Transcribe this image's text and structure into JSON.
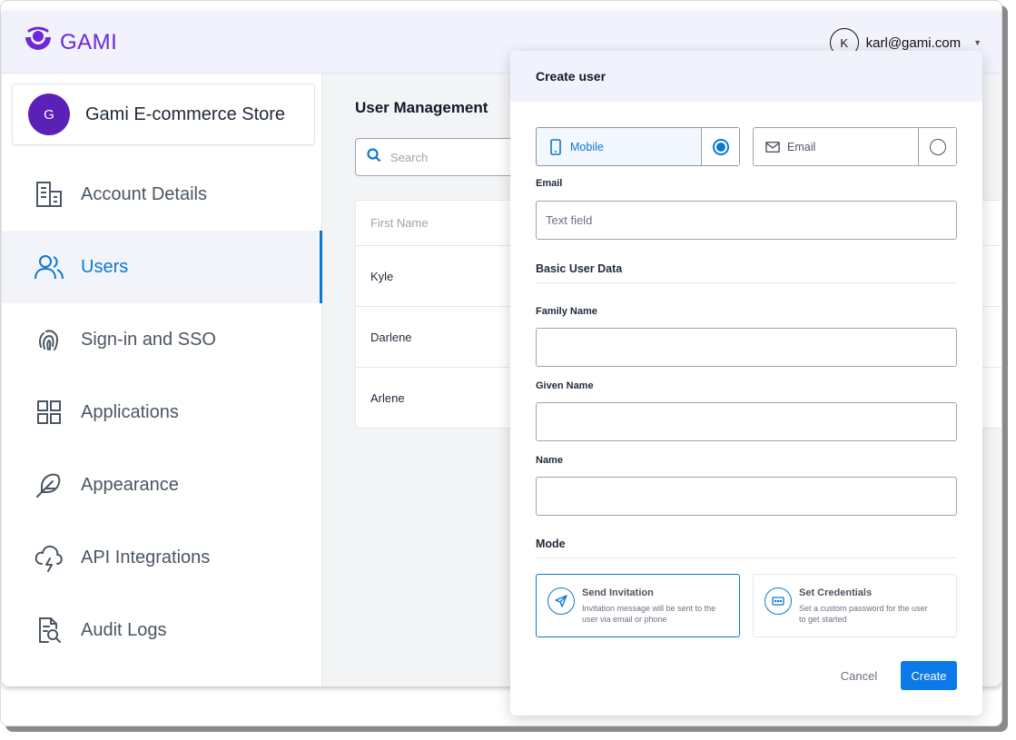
{
  "brand": {
    "name": "GAMI",
    "color": "#6d28d9"
  },
  "user_menu": {
    "avatar_initial": "K",
    "email": "karl@gami.com"
  },
  "organization": {
    "avatar_initial": "G",
    "name": "Gami E-commerce Store"
  },
  "sidebar": {
    "items": [
      {
        "label": "Account Details",
        "icon": "building-icon",
        "active": false
      },
      {
        "label": "Users",
        "icon": "users-icon",
        "active": true
      },
      {
        "label": "Sign-in and SSO",
        "icon": "fingerprint-icon",
        "active": false
      },
      {
        "label": "Applications",
        "icon": "grid-icon",
        "active": false
      },
      {
        "label": "Appearance",
        "icon": "feather-icon",
        "active": false
      },
      {
        "label": "API Integrations",
        "icon": "cloud-bolt-icon",
        "active": false
      },
      {
        "label": "Audit Logs",
        "icon": "file-search-icon",
        "active": false
      }
    ]
  },
  "main": {
    "title": "User Management",
    "search_placeholder": "Search",
    "table": {
      "header": "First Name",
      "rows": [
        "Kyle",
        "Darlene",
        "Arlene"
      ]
    }
  },
  "modal": {
    "title": "Create user",
    "contact_options": [
      {
        "label": "Mobile",
        "icon": "phone-icon",
        "selected": true
      },
      {
        "label": "Email",
        "icon": "mail-icon",
        "selected": false
      }
    ],
    "email_label": "Email",
    "email_placeholder": "Text field",
    "basic_section": "Basic User Data",
    "family_name_label": "Family Name",
    "given_name_label": "Given Name",
    "name_label": "Name",
    "mode_section": "Mode",
    "modes": [
      {
        "title": "Send Invitation",
        "description": "Invitation message will be sent to the user via email or phone",
        "icon": "send-icon",
        "selected": true
      },
      {
        "title": "Set Credentials",
        "description": "Set a custom password for the user to get started",
        "icon": "password-icon",
        "selected": false
      }
    ],
    "cancel_label": "Cancel",
    "create_label": "Create"
  },
  "colors": {
    "accent": "#0b79d0",
    "primary_button": "#0b79e8",
    "header_bg": "#f1f2fc"
  }
}
